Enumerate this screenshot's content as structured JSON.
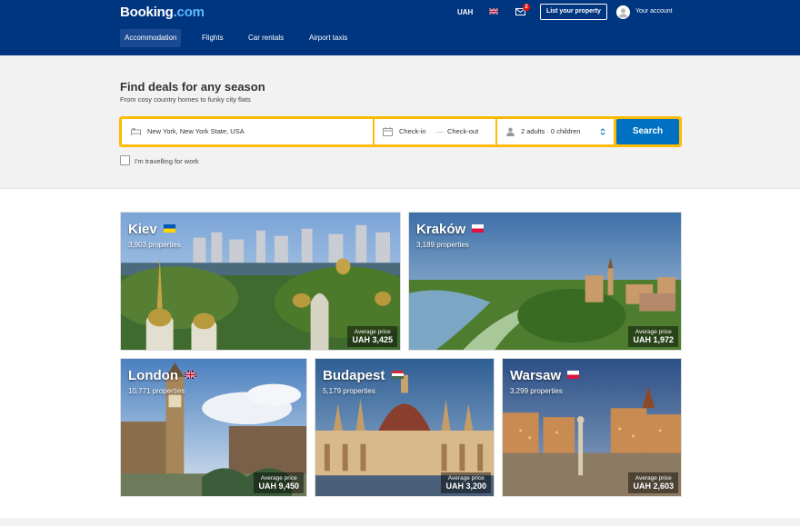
{
  "header": {
    "logo_main": "Booking",
    "logo_suffix": ".com",
    "currency": "UAH",
    "mail_badge": "2",
    "list_property": "List your property",
    "account": "Your account",
    "tabs": [
      {
        "label": "Accommodation",
        "active": true
      },
      {
        "label": "Flights",
        "active": false
      },
      {
        "label": "Car rentals",
        "active": false
      },
      {
        "label": "Airport taxis",
        "active": false
      }
    ]
  },
  "hero": {
    "title": "Find deals for any season",
    "subtitle": "From cosy country homes to funky city flats"
  },
  "search": {
    "destination": "New York, New York State, USA",
    "checkin": "Check-in",
    "dash": "—",
    "checkout": "Check-out",
    "guests": "2 adults · 0 children",
    "button": "Search",
    "work_travel": "I'm travelling for work"
  },
  "destinations": [
    {
      "city": "Kiev",
      "properties": "3,903 properties",
      "price_caption": "Average price",
      "price": "UAH 3,425",
      "flag": "ukraine-flag"
    },
    {
      "city": "Kraków",
      "properties": "3,189 properties",
      "price_caption": "Average price",
      "price": "UAH 1,972",
      "flag": "poland-flag"
    },
    {
      "city": "London",
      "properties": "10,771 properties",
      "price_caption": "Average price",
      "price": "UAH 9,450",
      "flag": "uk-flag"
    },
    {
      "city": "Budapest",
      "properties": "5,179 properties",
      "price_caption": "Average price",
      "price": "UAH 3,200",
      "flag": "hungary-flag"
    },
    {
      "city": "Warsaw",
      "properties": "3,299 properties",
      "price_caption": "Average price",
      "price": "UAH 2,603",
      "flag": "poland-flag"
    }
  ],
  "colors": {
    "brand_dark": "#003580",
    "search_border": "#febb02",
    "search_button": "#0071c2"
  }
}
